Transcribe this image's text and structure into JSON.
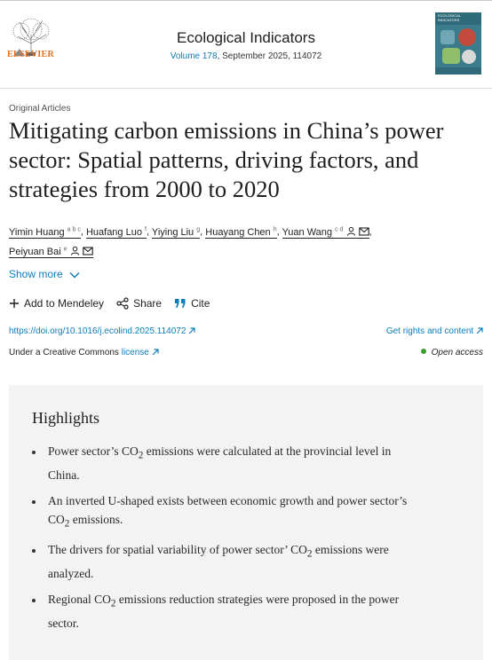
{
  "publisher": {
    "name": "ELSEVIER"
  },
  "journal": {
    "title": "Ecological Indicators",
    "volume_link": "Volume 178",
    "issue_rest": ", September 2025, 114072"
  },
  "cover": {
    "title": "ECOLOGICAL INDICATORS"
  },
  "article": {
    "section": "Original Articles",
    "title": "Mitigating carbon emissions in China’s power sector: Spatial patterns, driving factors, and strategies from 2000 to 2020"
  },
  "authors": [
    {
      "name": "Yimin Huang",
      "sup": "a b c"
    },
    {
      "name": "Huafang Luo",
      "sup": "f"
    },
    {
      "name": "Yiying Liu",
      "sup": "g"
    },
    {
      "name": "Huayang Chen",
      "sup": "h"
    },
    {
      "name": "Yuan Wang",
      "sup": "c d"
    },
    {
      "name": "Peiyuan Bai",
      "sup": "e"
    }
  ],
  "show_more": "Show more",
  "actions": {
    "mendeley": "Add to Mendeley",
    "share": "Share",
    "cite": "Cite"
  },
  "doi": "https://doi.org/10.1016/j.ecolind.2025.114072",
  "rights": "Get rights and content",
  "license": {
    "prefix": "Under a Creative Commons ",
    "link": "license"
  },
  "open_access": "Open access",
  "highlights": {
    "title": "Highlights",
    "items": [
      {
        "pre": "Power sector’s CO",
        "sub": "2",
        "post": " emissions were calculated at the provincial level in China."
      },
      {
        "pre": "An inverted U-shaped exists between economic growth and power sector’s CO",
        "sub": "2",
        "post": " emissions."
      },
      {
        "pre": "The drivers for spatial variability of power sector’ CO",
        "sub": "2",
        "post": " emissions were analyzed."
      },
      {
        "pre": "Regional CO",
        "sub": "2",
        "post": " emissions reduction strategies were proposed in the power sector."
      }
    ]
  },
  "colors": {
    "link": "#0c7dbb",
    "elsevier_orange": "#e9711c",
    "open_access_green": "#3e9d2c",
    "highlights_bg": "#f3f3f3"
  }
}
